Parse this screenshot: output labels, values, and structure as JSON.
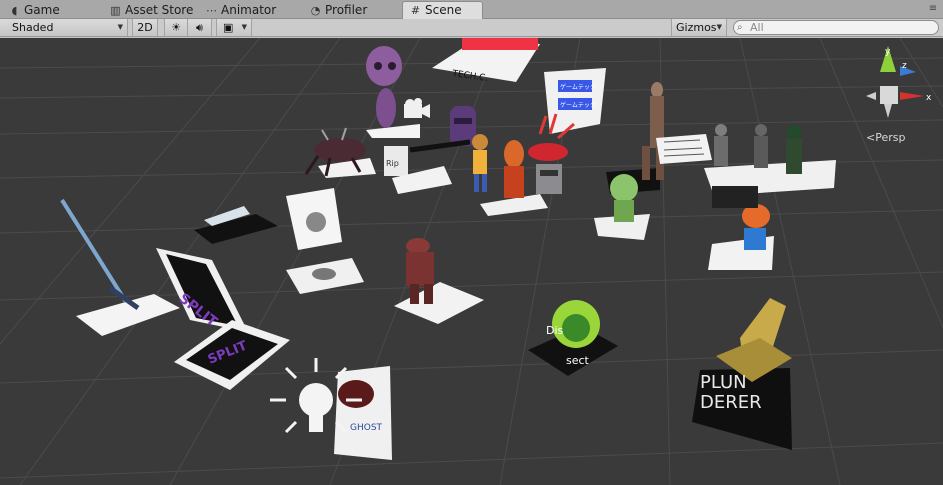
{
  "tabs": [
    {
      "label": "Game",
      "icon": "pacman-icon"
    },
    {
      "label": "Asset Store",
      "icon": "store-icon"
    },
    {
      "label": "Animator",
      "icon": "animator-icon"
    },
    {
      "label": "Profiler",
      "icon": "profiler-icon"
    },
    {
      "label": "Scene",
      "icon": "grid-icon",
      "active": true
    }
  ],
  "toolbar": {
    "shading_mode": "Shaded",
    "mode_2d": "2D",
    "gizmos": "Gizmos",
    "search_placeholder": "All"
  },
  "scene": {
    "projection": "Persp",
    "gizmo_axes": {
      "x": "x",
      "y": "y",
      "z": "z"
    },
    "marker_texts": {
      "split_a": "SPLIT",
      "split_b": "SPLIT",
      "dissect_1": "Dis",
      "dissect_2": "sect",
      "plunderer_1": "PLUN",
      "plunderer_2": "DERER",
      "ghost": "GHOST",
      "tech": "TECH.C.",
      "rip": "Rip",
      "ad_line1": "ゲームテック",
      "ad_line2": "ゲームテック"
    }
  },
  "colors": {
    "scene_bg": "#3a3a3a",
    "grid": "#4b4b4b",
    "axis_x": "#d0342c",
    "axis_y": "#8fd13a",
    "axis_z": "#3a7bd5"
  }
}
